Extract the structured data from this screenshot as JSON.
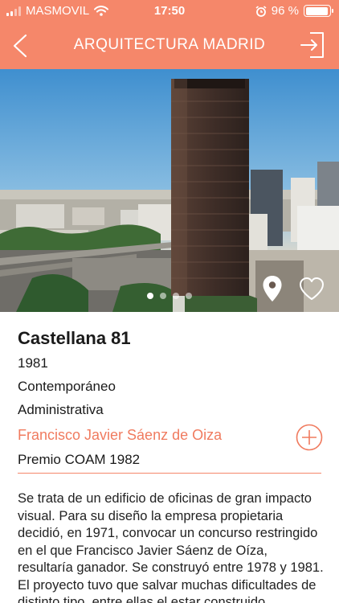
{
  "status_bar": {
    "carrier": "MASMOVIL",
    "time": "17:50",
    "battery": "96 %",
    "battery_level": 0.96
  },
  "nav": {
    "title": "ARQUITECTURA MADRID"
  },
  "gallery": {
    "image_count": 4,
    "active_index": 0
  },
  "building": {
    "name": "Castellana 81",
    "year": "1981",
    "style": "Contemporáneo",
    "use": "Administrativa",
    "architect": "Francisco Javier Sáenz de Oiza",
    "award": "Premio COAM 1982",
    "description": "Se trata de un edificio de oficinas de gran impacto visual. Para su diseño la empresa propietaria decidió, en 1971, convocar un concurso restringido en el que Francisco Javier Sáenz de Oíza, resultaría ganador. Se construyó entre 1978 y 1981. El proyecto tuvo que salvar muchas dificultades de distinto tipo, entre ellas el estar construido"
  },
  "colors": {
    "accent": "#f5876a",
    "link": "#f07b5f",
    "text": "#1a1a1a"
  },
  "icons": [
    "back-icon",
    "exit-icon",
    "location-pin-icon",
    "heart-icon",
    "plus-icon",
    "wifi-icon",
    "alarm-icon",
    "battery-icon",
    "signal-icon"
  ]
}
